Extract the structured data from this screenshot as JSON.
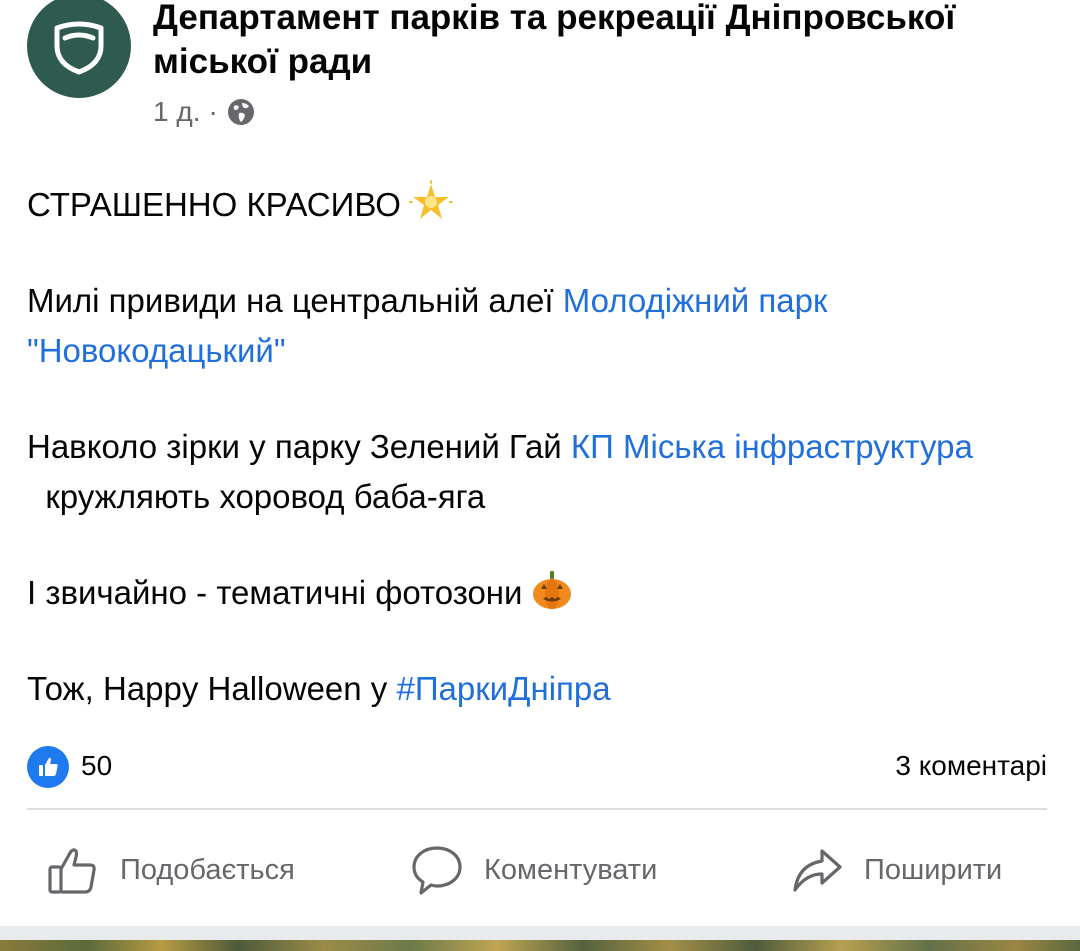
{
  "post": {
    "page_name": "Департамент парків та рекреації Дніпровської міської ради",
    "timestamp": "1 д.",
    "separator": "·",
    "audience_icon": "globe-icon",
    "lines": {
      "headline": "СТРАШЕННО КРАСИВО",
      "headline_emoji": "glowing-star-emoji",
      "p1_text": "Милі привиди на центральній алеї ",
      "p1_link": "Молодіжний парк \"Новокодацький\"",
      "p2_text": "Навколо зірки у парку Зелений Гай ",
      "p2_link": "КП Міська інфраструктура",
      "p2_tail": "  кружляють хоровод баба-яга",
      "p3_text": "І звичайно - тематичні фотозони",
      "p3_emoji": "jack-o-lantern-emoji",
      "p4_text": "Тож, Happy Halloween у ",
      "p4_hashtag": "#ПаркиДніпра"
    }
  },
  "reactions": {
    "like_count": "50",
    "comments_count": "3 коментарі"
  },
  "actions": {
    "like_label": "Подобається",
    "comment_label": "Коментувати",
    "share_label": "Поширити"
  },
  "colors": {
    "link": "#216fdb",
    "avatar_bg": "#2e5a4f",
    "like_badge": "#1f7af0",
    "secondary_text": "#65676b"
  }
}
